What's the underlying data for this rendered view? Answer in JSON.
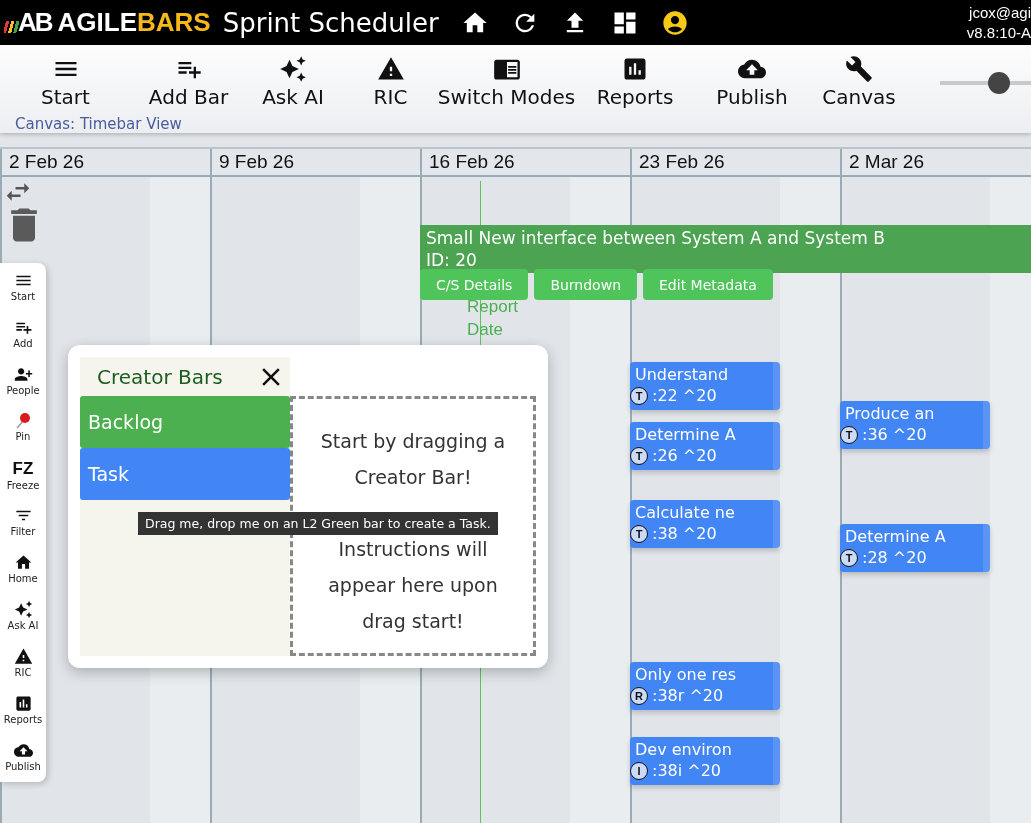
{
  "header": {
    "logo_mark": "AB",
    "brand_first": "AGILE",
    "brand_second": "BARS",
    "title": "Sprint Scheduler",
    "icons": [
      {
        "kind": "home"
      },
      {
        "kind": "refresh"
      },
      {
        "kind": "upload"
      },
      {
        "kind": "dashboard"
      },
      {
        "kind": "account"
      }
    ],
    "user": "jcox@agi",
    "version": "v8.8:10-A"
  },
  "toolbar": {
    "items": [
      {
        "label": "Start",
        "kind": "menu"
      },
      {
        "label": "Add Bar",
        "kind": "add"
      },
      {
        "label": "Ask AI",
        "kind": "ai"
      },
      {
        "label": "RIC",
        "kind": "warning"
      },
      {
        "label": "Switch Modes",
        "kind": "modes"
      },
      {
        "label": "Reports",
        "kind": "reports"
      },
      {
        "label": "Publish",
        "kind": "publish"
      },
      {
        "label": "Canvas",
        "kind": "wrench"
      }
    ],
    "canvas_mode": "Canvas: Timebar View",
    "zoom_slider": {
      "level": 0.45
    }
  },
  "timeline": {
    "weeks": [
      "2 Feb 26",
      "9 Feb 26",
      "16 Feb 26",
      "23 Feb 26",
      "2 Mar 26"
    ],
    "report_date_label": "Report Date"
  },
  "sidebar": {
    "items": [
      {
        "label": "Start",
        "kind": "menu"
      },
      {
        "label": "Add",
        "kind": "add"
      },
      {
        "label": "People",
        "kind": "people"
      },
      {
        "label": "Pin",
        "kind": "pin"
      },
      {
        "label": "Freeze",
        "kind": "text",
        "glyph": "FZ"
      },
      {
        "label": "Filter",
        "kind": "filter"
      },
      {
        "label": "Home",
        "kind": "home"
      },
      {
        "label": "Ask AI",
        "kind": "ai"
      },
      {
        "label": "RIC",
        "kind": "warning"
      },
      {
        "label": "Reports",
        "kind": "reports"
      },
      {
        "label": "Publish",
        "kind": "publish"
      }
    ]
  },
  "epic_bar": {
    "title": "Small New interface between System A and System B",
    "id": "ID: 20",
    "actions": [
      "C/S Details",
      "Burndown",
      "Edit Metadata"
    ]
  },
  "tasks": [
    {
      "title": "Understand",
      "badge": "T",
      "code": ":22 ^20"
    },
    {
      "title": "Determine A",
      "badge": "T",
      "code": ":26 ^20"
    },
    {
      "title": "Calculate ne",
      "badge": "T",
      "code": ":38 ^20"
    },
    {
      "title": "Produce an",
      "badge": "T",
      "code": ":36 ^20"
    },
    {
      "title": "Determine A",
      "badge": "T",
      "code": ":28 ^20"
    },
    {
      "title": "Only one res",
      "badge": "R",
      "code": ":38r ^20"
    },
    {
      "title": "Dev environ",
      "badge": "I",
      "code": ":38i ^20"
    }
  ],
  "creator_dialog": {
    "title": "Creator Bars",
    "bars": [
      {
        "label": "Backlog",
        "color": "#4caf50"
      },
      {
        "label": "Task",
        "color": "#4285f4"
      }
    ],
    "drop_zone": {
      "heading": "Start by dragging a Creator Bar!",
      "hint": "Instructions will appear here upon drag start!"
    },
    "tooltip": "Drag me, drop me on an L2 Green bar to create a Task."
  }
}
